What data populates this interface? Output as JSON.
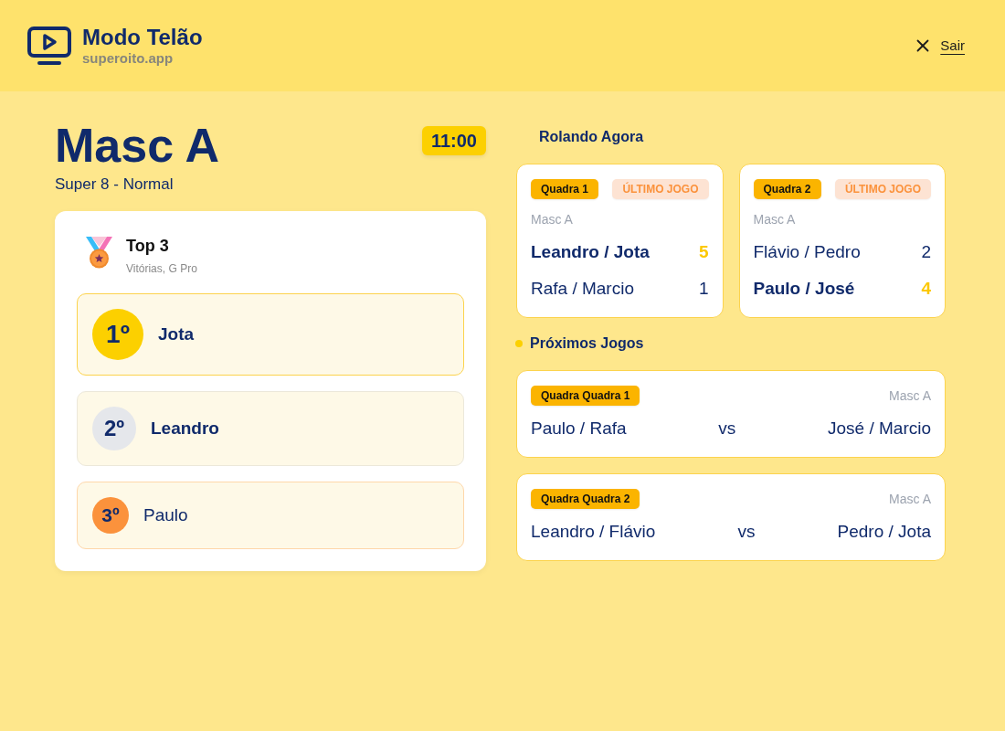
{
  "header": {
    "title": "Modo Telão",
    "subtitle": "superoito.app",
    "exit_label": "Sair"
  },
  "category": {
    "title": "Masc A",
    "subtitle": "Super 8 - Normal",
    "time": "11:00"
  },
  "ranking": {
    "title": "Top 3",
    "subtitle": "Vitórias, G Pro",
    "entries": [
      {
        "position": "1º",
        "name": "Jota",
        "kind": "gold"
      },
      {
        "position": "2º",
        "name": "Leandro",
        "kind": "silver"
      },
      {
        "position": "3º",
        "name": "Paulo",
        "kind": "bronze"
      }
    ]
  },
  "live": {
    "title": "Rolando Agora",
    "courts": [
      {
        "court": "Quadra 1",
        "tag": "ÚLTIMO JOGO",
        "category": "Masc A",
        "teams": [
          {
            "name": "Leandro / Jota",
            "score": "5",
            "winner": true
          },
          {
            "name": "Rafa / Marcio",
            "score": "1",
            "winner": false
          }
        ]
      },
      {
        "court": "Quadra 2",
        "tag": "ÚLTIMO JOGO",
        "category": "Masc A",
        "teams": [
          {
            "name": "Flávio / Pedro",
            "score": "2",
            "winner": false
          },
          {
            "name": "Paulo / José",
            "score": "4",
            "winner": true
          }
        ]
      }
    ]
  },
  "upcoming": {
    "title": "Próximos Jogos",
    "games": [
      {
        "court": "Quadra Quadra 1",
        "category": "Masc A",
        "team_a": "Paulo / Rafa",
        "separator": "vs",
        "team_b": "José / Marcio"
      },
      {
        "court": "Quadra Quadra 2",
        "category": "Masc A",
        "team_a": "Leandro / Flávio",
        "separator": "vs",
        "team_b": "Pedro / Jota"
      }
    ]
  }
}
